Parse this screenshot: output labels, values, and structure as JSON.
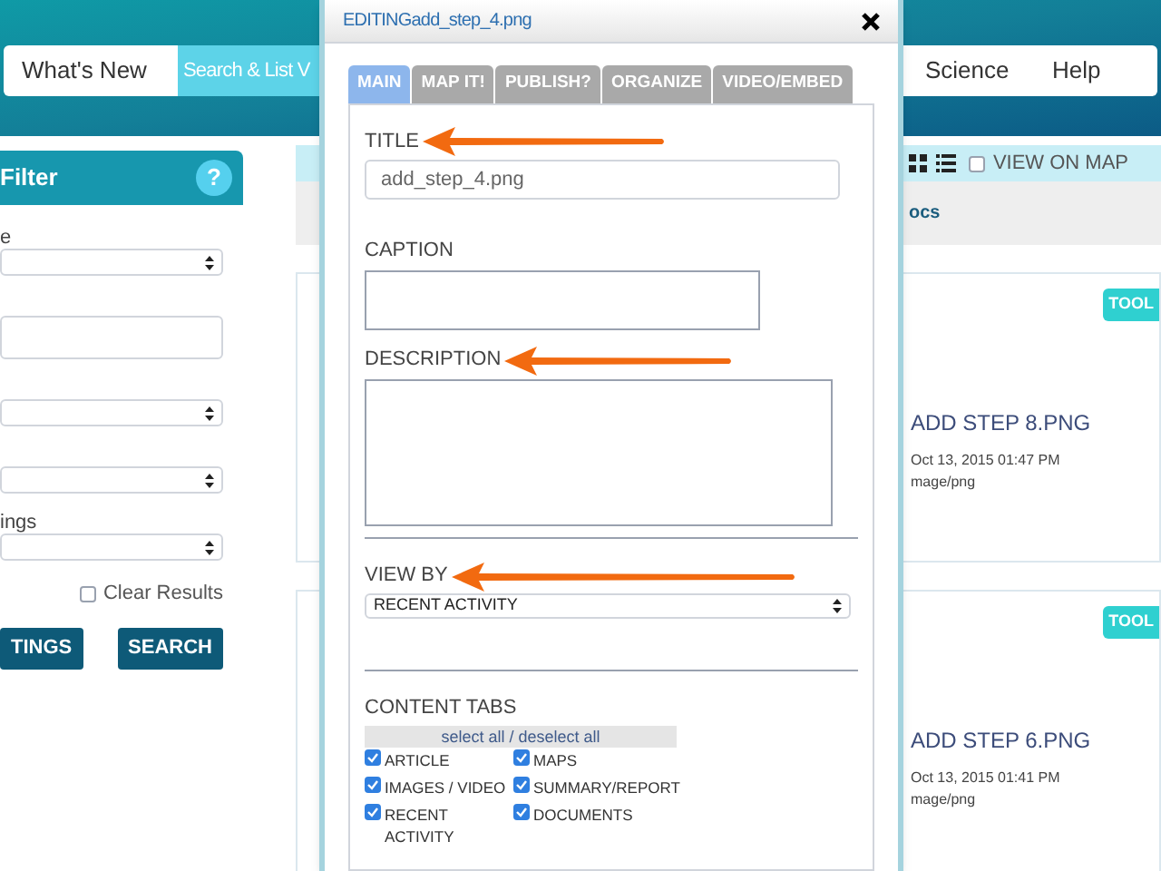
{
  "nav": {
    "items": [
      {
        "label": "What's New",
        "selected": false
      },
      {
        "label": "Search & List V",
        "selected": true
      },
      {
        "label": "Science",
        "selected": false
      },
      {
        "label": "Help",
        "selected": false
      }
    ]
  },
  "filter": {
    "title": "Filter",
    "help": "?",
    "fields": [
      {
        "kind": "select",
        "label": "e"
      },
      {
        "kind": "input"
      },
      {
        "kind": "select"
      },
      {
        "kind": "select"
      },
      {
        "kind": "select",
        "label": "ings"
      }
    ],
    "clear_results": {
      "label": "Clear Results",
      "checked": false
    },
    "buttons": [
      "TINGS",
      "SEARCH"
    ]
  },
  "results": {
    "view_on_map": {
      "label": "VIEW ON MAP",
      "checked": false
    },
    "tab_label": "ocs",
    "cards": [
      {
        "badge": "TOOL",
        "title": "ADD STEP 8.PNG",
        "date": "Oct 13, 2015 01:47 PM",
        "type": "mage/png"
      },
      {
        "badge": "TOOL",
        "title": "ADD STEP 6.PNG",
        "date": "Oct 13, 2015 01:41 PM",
        "type": "mage/png"
      }
    ]
  },
  "dialog": {
    "title": "EDITINGadd_step_4.png",
    "tabs": [
      {
        "label": "MAIN",
        "selected": true
      },
      {
        "label": "MAP IT!",
        "selected": false
      },
      {
        "label": "PUBLISH?",
        "selected": false
      },
      {
        "label": "ORGANIZE",
        "selected": false
      },
      {
        "label": "VIDEO/EMBED",
        "selected": false
      }
    ],
    "title_field": {
      "label": "TITLE",
      "value": "add_step_4.png"
    },
    "caption": {
      "label": "CAPTION"
    },
    "description": {
      "label": "DESCRIPTION"
    },
    "view_by": {
      "label": "VIEW BY",
      "value": "RECENT ACTIVITY"
    },
    "content_tabs": {
      "label": "CONTENT TABS",
      "select_all": "select all / deselect all",
      "items": [
        {
          "label": "ARTICLE",
          "checked": true
        },
        {
          "label": "MAPS",
          "checked": true
        },
        {
          "label": "IMAGES / VIDEO",
          "checked": true
        },
        {
          "label": "SUMMARY/REPORT",
          "checked": true
        },
        {
          "label": "RECENT ACTIVITY",
          "checked": true
        },
        {
          "label": "DOCUMENTS",
          "checked": true
        }
      ]
    }
  }
}
